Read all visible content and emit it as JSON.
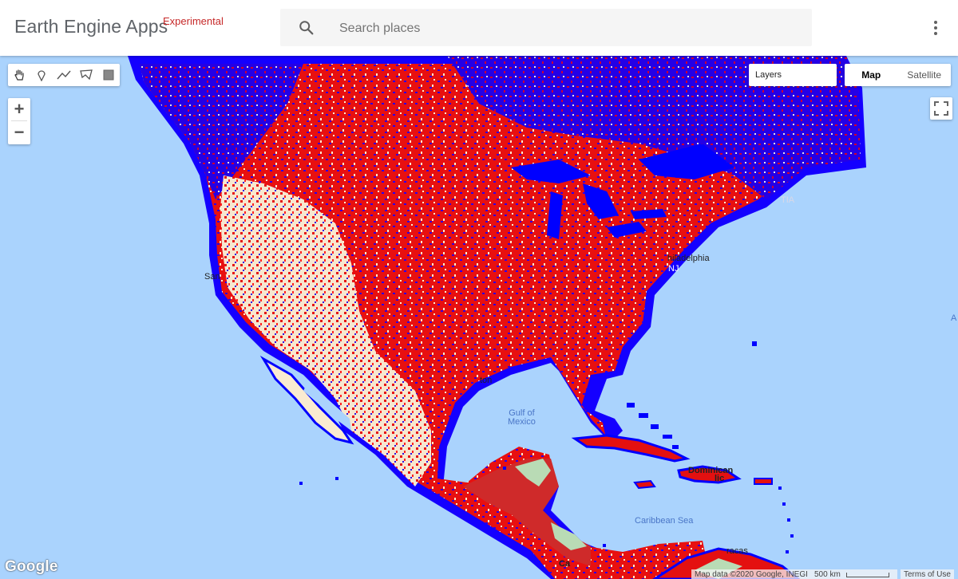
{
  "header": {
    "app_title": "Earth Engine Apps",
    "badge": "Experimental",
    "search": {
      "placeholder": "Search places",
      "value": ""
    },
    "menu_icon": "more-vert-icon"
  },
  "map": {
    "drawing_tools": [
      "hand-pan-icon",
      "marker-icon",
      "polyline-icon",
      "polygon-icon",
      "rectangle-icon"
    ],
    "zoom_in": "+",
    "zoom_out": "−",
    "layers_label": "Layers",
    "map_types": {
      "map": "Map",
      "satellite": "Satellite",
      "selected": "Map"
    },
    "fullscreen_icon": "fullscreen-icon",
    "labels": {
      "san": "San",
      "philadelphia": "hiladelphia",
      "nj": "NJ",
      "gulf": [
        "Gulf of",
        "Mexico"
      ],
      "caribbean": "Caribbean Sea",
      "dominican": "Dominican",
      "republic": "lic",
      "ton": "ton",
      "a_right": "A",
      "tia": "TIA",
      "caracas": "racas",
      "ca": "Ca"
    },
    "google_logo": "Google",
    "attribution": "Map data ©2020 Google, INEGI",
    "scale": "500 km",
    "terms": "Terms of Use",
    "colors": {
      "ocean": "#aad3fd",
      "water_layer": "#0000ff",
      "red_layer": "#ff0000",
      "bare_layer": "#faebd0",
      "vegetation": "#b9dbb5"
    }
  }
}
